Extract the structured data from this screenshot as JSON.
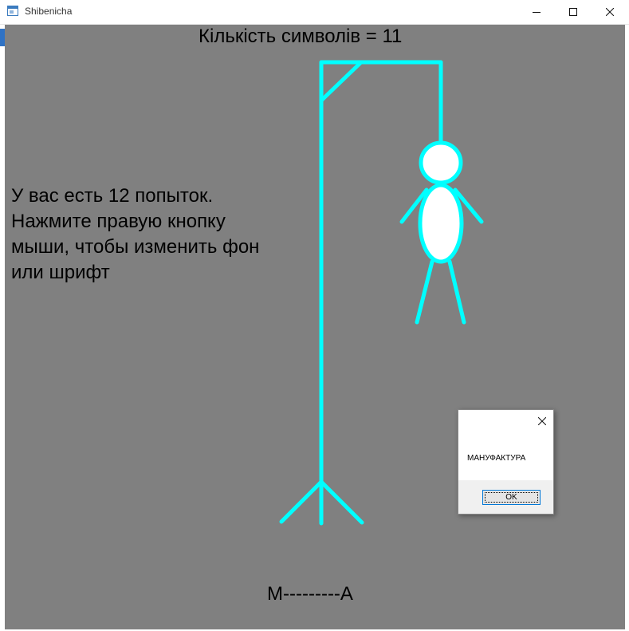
{
  "window": {
    "title": "Shibenicha",
    "minimize_glyph": "—",
    "maximize_glyph": "□",
    "close_glyph": "✕"
  },
  "game": {
    "char_count_text": "Кількість символів = 11",
    "instructions": [
      "У вас есть 12 попыток.",
      "Нажмите правую кнопку",
      "мыши, чтобы изменить фон",
      "или шрифт"
    ],
    "word_display": "М---------А",
    "background_color": "#808080",
    "drawing_color": "#00ffff"
  },
  "dialog": {
    "message": "МАНУФАКТУРА",
    "ok_label": "OK"
  },
  "icons": {
    "app": "app-window-icon",
    "minimize": "minimize-icon",
    "maximize": "maximize-icon",
    "close": "close-icon",
    "dialog_close": "dialog-close-icon"
  }
}
